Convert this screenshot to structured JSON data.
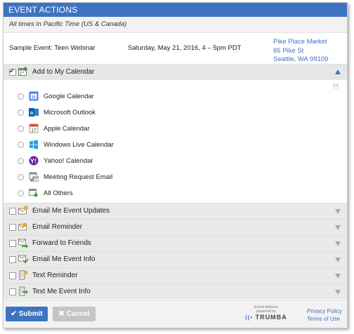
{
  "header": {
    "title": "EVENT ACTIONS"
  },
  "timezone_note": "All times in Pacific Time (US & Canada)",
  "event": {
    "name": "Sample Event: Teen Webinar",
    "datetime": "Saturday, May 21, 2016, 4 – 5pm PDT",
    "location": [
      "Pike Place Market",
      "85 Pike St",
      "Seattle, WA 98109"
    ]
  },
  "calendar_section": {
    "label": "Add to My Calendar",
    "checked": true,
    "help": "[?]",
    "options": [
      {
        "label": "Google Calendar",
        "icon": "google-calendar-icon"
      },
      {
        "label": "Microsoft Outlook",
        "icon": "outlook-icon"
      },
      {
        "label": "Apple Calendar",
        "icon": "apple-calendar-icon"
      },
      {
        "label": "Windows Live Calendar",
        "icon": "windows-icon"
      },
      {
        "label": "Yahoo! Calendar",
        "icon": "yahoo-icon"
      },
      {
        "label": "Meeting Request Email",
        "icon": "meeting-request-icon"
      },
      {
        "label": "All Others",
        "icon": "download-calendar-icon"
      }
    ]
  },
  "sections": [
    {
      "label": "Email Me Event Updates",
      "icon": "email-updates-icon"
    },
    {
      "label": "Email Reminder",
      "icon": "email-reminder-icon"
    },
    {
      "label": "Forward to Friends",
      "icon": "forward-icon"
    },
    {
      "label": "Email Me Event Info",
      "icon": "email-info-icon"
    },
    {
      "label": "Text Reminder",
      "icon": "text-reminder-icon"
    },
    {
      "label": "Text Me Event Info",
      "icon": "text-info-icon"
    }
  ],
  "footer": {
    "submit_label": "Submit",
    "cancel_label": "Cancel",
    "powered_line1": "Event Actions",
    "powered_line2": "powered by",
    "brand": "TRUMBA",
    "privacy_label": "Privacy Policy",
    "terms_label": "Terms of Use"
  },
  "colors": {
    "accent": "#3d74c2",
    "section_bg": "#e9e9e9",
    "cancel_bg": "#c5c5c5"
  }
}
